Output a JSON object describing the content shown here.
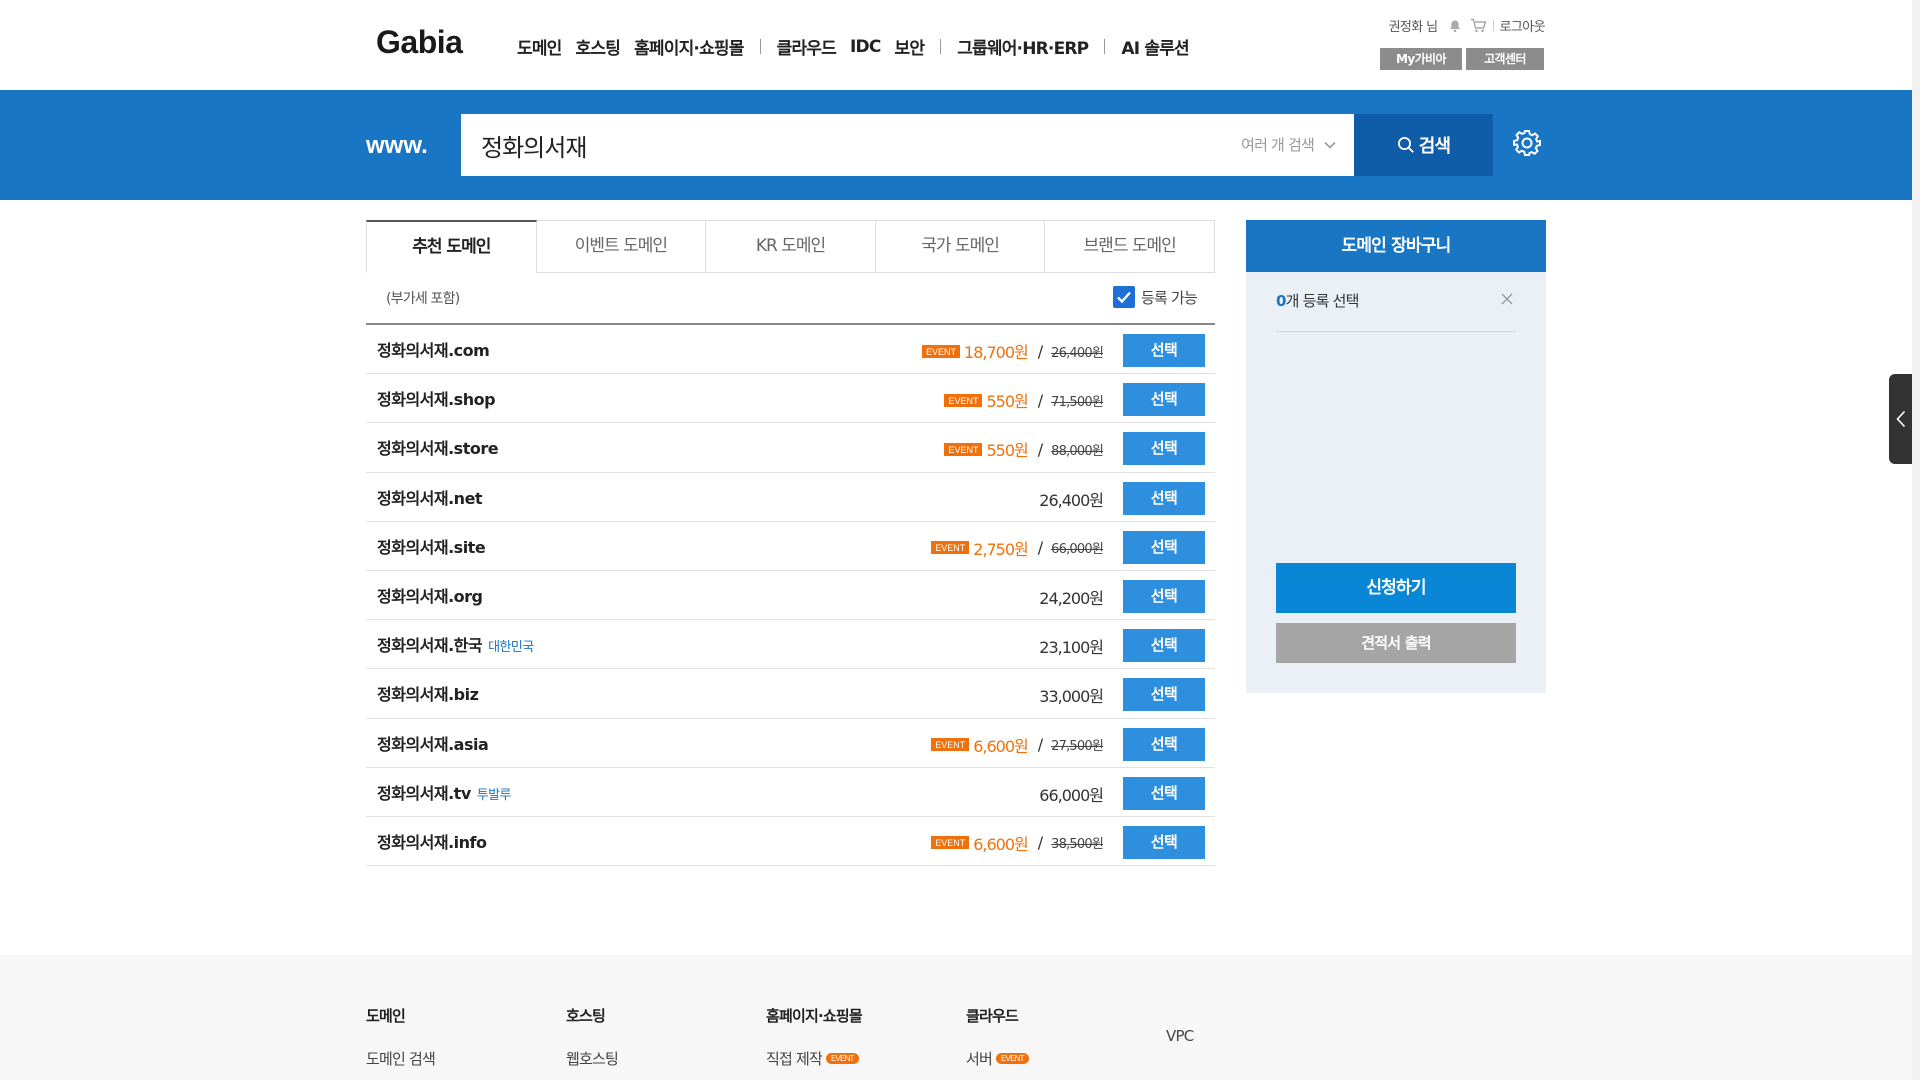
{
  "header": {
    "logo": "Gabia",
    "nav": {
      "group1": [
        "도메인",
        "호스팅",
        "홈페이지·쇼핑몰"
      ],
      "group2": [
        "클라우드",
        "IDC",
        "보안"
      ],
      "group3": [
        "그룹웨어·HR·ERP"
      ],
      "group4": [
        "AI 솔루션"
      ]
    },
    "user_name": "권정화 님",
    "logout": "로그아웃",
    "my_gabia": "My가비아",
    "support": "고객센터"
  },
  "search": {
    "prefix": "www.",
    "query": "정화의서재",
    "multi_search": "여러 개 검색",
    "button": "검색"
  },
  "tabs": [
    {
      "label": "추천 도메인",
      "active": true
    },
    {
      "label": "이벤트 도메인",
      "active": false
    },
    {
      "label": "KR 도메인",
      "active": false
    },
    {
      "label": "국가 도메인",
      "active": false
    },
    {
      "label": "브랜드 도메인",
      "active": false
    }
  ],
  "subbar": {
    "vat": "(부가세 포함)",
    "available": "등록 가능"
  },
  "results": [
    {
      "domain": "정화의서재.com",
      "note": "",
      "event_label": "EVENT",
      "event_price": "18,700원",
      "original_price": "26,400원",
      "price": "",
      "button": "선택"
    },
    {
      "domain": "정화의서재.shop",
      "note": "",
      "event_label": "EVENT",
      "event_price": "550원",
      "original_price": "71,500원",
      "price": "",
      "button": "선택"
    },
    {
      "domain": "정화의서재.store",
      "note": "",
      "event_label": "EVENT",
      "event_price": "550원",
      "original_price": "88,000원",
      "price": "",
      "button": "선택"
    },
    {
      "domain": "정화의서재.net",
      "note": "",
      "event_label": "",
      "event_price": "",
      "original_price": "",
      "price": "26,400원",
      "button": "선택"
    },
    {
      "domain": "정화의서재.site",
      "note": "",
      "event_label": "EVENT",
      "event_price": "2,750원",
      "original_price": "66,000원",
      "price": "",
      "button": "선택"
    },
    {
      "domain": "정화의서재.org",
      "note": "",
      "event_label": "",
      "event_price": "",
      "original_price": "",
      "price": "24,200원",
      "button": "선택"
    },
    {
      "domain": "정화의서재.한국",
      "note": "대한민국",
      "event_label": "",
      "event_price": "",
      "original_price": "",
      "price": "23,100원",
      "button": "선택"
    },
    {
      "domain": "정화의서재.biz",
      "note": "",
      "event_label": "",
      "event_price": "",
      "original_price": "",
      "price": "33,000원",
      "button": "선택"
    },
    {
      "domain": "정화의서재.asia",
      "note": "",
      "event_label": "EVENT",
      "event_price": "6,600원",
      "original_price": "27,500원",
      "price": "",
      "button": "선택"
    },
    {
      "domain": "정화의서재.tv",
      "note": "투발루",
      "event_label": "",
      "event_price": "",
      "original_price": "",
      "price": "66,000원",
      "button": "선택"
    },
    {
      "domain": "정화의서재.info",
      "note": "",
      "event_label": "EVENT",
      "event_price": "6,600원",
      "original_price": "38,500원",
      "price": "",
      "button": "선택"
    }
  ],
  "cart": {
    "title": "도메인 장바구니",
    "count": "0",
    "count_suffix": "개 등록 선택",
    "apply": "신청하기",
    "quote": "견적서 출력"
  },
  "footer": {
    "columns": [
      {
        "heading": "도메인",
        "items": [
          {
            "label": "도메인 검색",
            "badge": ""
          }
        ]
      },
      {
        "heading": "호스팅",
        "items": [
          {
            "label": "웹호스팅",
            "badge": ""
          }
        ]
      },
      {
        "heading": "홈페이지·쇼핑몰",
        "items": [
          {
            "label": "직접 제작",
            "badge": "EVENT"
          }
        ]
      },
      {
        "heading": "클라우드",
        "items": [
          {
            "label": "서버",
            "badge": "EVENT"
          }
        ]
      },
      {
        "heading": "",
        "items": [
          {
            "label": "VPC",
            "badge": ""
          }
        ]
      }
    ]
  },
  "colors": {
    "brand_blue": "#1976c5",
    "button_blue": "#2e8fde",
    "event_orange": "#f0710c"
  },
  "icons": [
    "bell-icon",
    "cart-icon",
    "chevron-down-icon",
    "search-icon",
    "gear-icon",
    "close-icon",
    "chevron-left-icon",
    "check-icon"
  ]
}
